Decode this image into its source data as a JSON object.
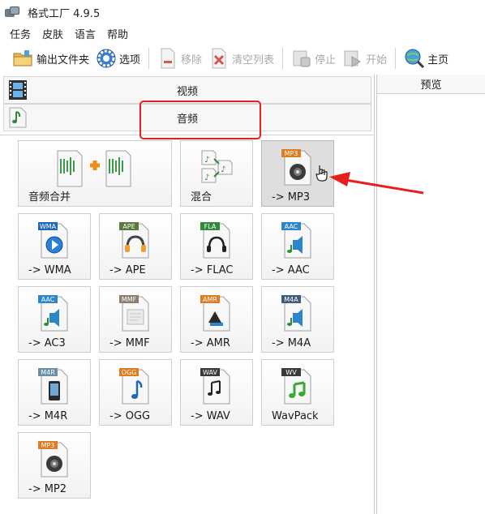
{
  "window": {
    "title": "格式工厂 4.9.5"
  },
  "menu": [
    "任务",
    "皮肤",
    "语言",
    "帮助"
  ],
  "toolbar": {
    "output_folder": "输出文件夹",
    "options": "选项",
    "remove": "移除",
    "clear_list": "清空列表",
    "stop": "停止",
    "start": "开始",
    "home": "主页"
  },
  "categories": {
    "video": "视频",
    "audio": "音频"
  },
  "preview": {
    "title": "预览"
  },
  "tiles": [
    {
      "label": "音频合并",
      "badge": ""
    },
    {
      "label": "混合",
      "badge": ""
    },
    {
      "label": "-> MP3",
      "badge": "MP3"
    },
    {
      "label": "-> WMA",
      "badge": "WMA"
    },
    {
      "label": "-> APE",
      "badge": "APE"
    },
    {
      "label": "-> FLAC",
      "badge": "FLA"
    },
    {
      "label": "-> AAC",
      "badge": "AAC"
    },
    {
      "label": "-> AC3",
      "badge": "AAC"
    },
    {
      "label": "-> MMF",
      "badge": "MMF"
    },
    {
      "label": "-> AMR",
      "badge": "AMR"
    },
    {
      "label": "-> M4A",
      "badge": "M4A"
    },
    {
      "label": "-> M4R",
      "badge": "M4R"
    },
    {
      "label": "-> OGG",
      "badge": "OGG"
    },
    {
      "label": "-> WAV",
      "badge": "WAV"
    },
    {
      "label": "WavPack",
      "badge": "WV"
    },
    {
      "label": "-> MP2",
      "badge": "MP3"
    }
  ],
  "colors": {
    "highlight": "#e8201d",
    "badge_mp3": "#e07b22",
    "badge_wma": "#1f66b8",
    "badge_ape": "#5b7a3a",
    "badge_fla": "#2f8a3c",
    "badge_aac": "#2d86c9",
    "badge_mmf": "#8a7f6c",
    "badge_amr": "#e07b22",
    "badge_m4a": "#3e5d7a",
    "badge_m4r": "#6b8fa6",
    "badge_ogg": "#e07b22",
    "badge_wav": "#3a3a3a",
    "badge_wv": "#3a3a3a"
  }
}
